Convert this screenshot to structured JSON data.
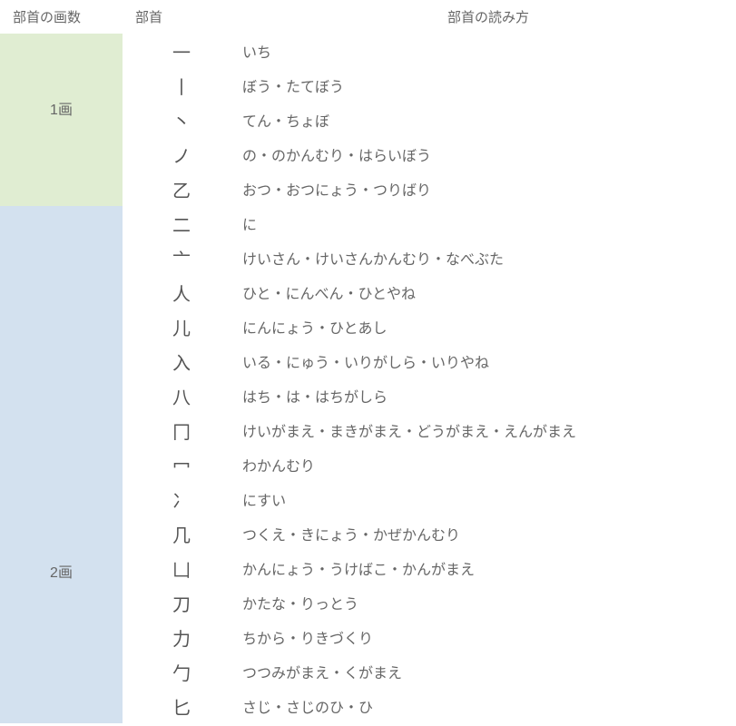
{
  "headers": {
    "strokes": "部首の画数",
    "radical": "部首",
    "reading": "部首の読み方"
  },
  "groups": [
    {
      "label": "1画",
      "cls": "g1",
      "rows": [
        {
          "radical": "一",
          "reading": "いち"
        },
        {
          "radical": "丨",
          "reading": "ぼう・たてぼう"
        },
        {
          "radical": "丶",
          "reading": "てん・ちょぼ"
        },
        {
          "radical": "ノ",
          "reading": "の・のかんむり・はらいぼう"
        },
        {
          "radical": "乙",
          "reading": "おつ・おつにょう・つりばり"
        }
      ]
    },
    {
      "label": "2画",
      "cls": "g2",
      "rows": [
        {
          "radical": "二",
          "reading": "に"
        },
        {
          "radical": "亠",
          "reading": "けいさん・けいさんかんむり・なべぶた"
        },
        {
          "radical": "人",
          "reading": "ひと・にんべん・ひとやね"
        },
        {
          "radical": "儿",
          "reading": "にんにょう・ひとあし"
        },
        {
          "radical": "入",
          "reading": "いる・にゅう・いりがしら・いりやね"
        },
        {
          "radical": "八",
          "reading": "はち・は・はちがしら"
        },
        {
          "radical": "冂",
          "reading": "けいがまえ・まきがまえ・どうがまえ・えんがまえ"
        },
        {
          "radical": "冖",
          "reading": "わかんむり"
        },
        {
          "radical": "冫",
          "reading": "にすい"
        },
        {
          "radical": "几",
          "reading": "つくえ・きにょう・かぜかんむり"
        },
        {
          "radical": "凵",
          "reading": "かんにょう・うけばこ・かんがまえ"
        },
        {
          "radical": "刀",
          "reading": "かたな・りっとう"
        },
        {
          "radical": "力",
          "reading": "ちから・りきづくり"
        },
        {
          "radical": "勹",
          "reading": "つつみがまえ・くがまえ"
        },
        {
          "radical": "匕",
          "reading": "さじ・さじのひ・ひ"
        }
      ]
    }
  ]
}
